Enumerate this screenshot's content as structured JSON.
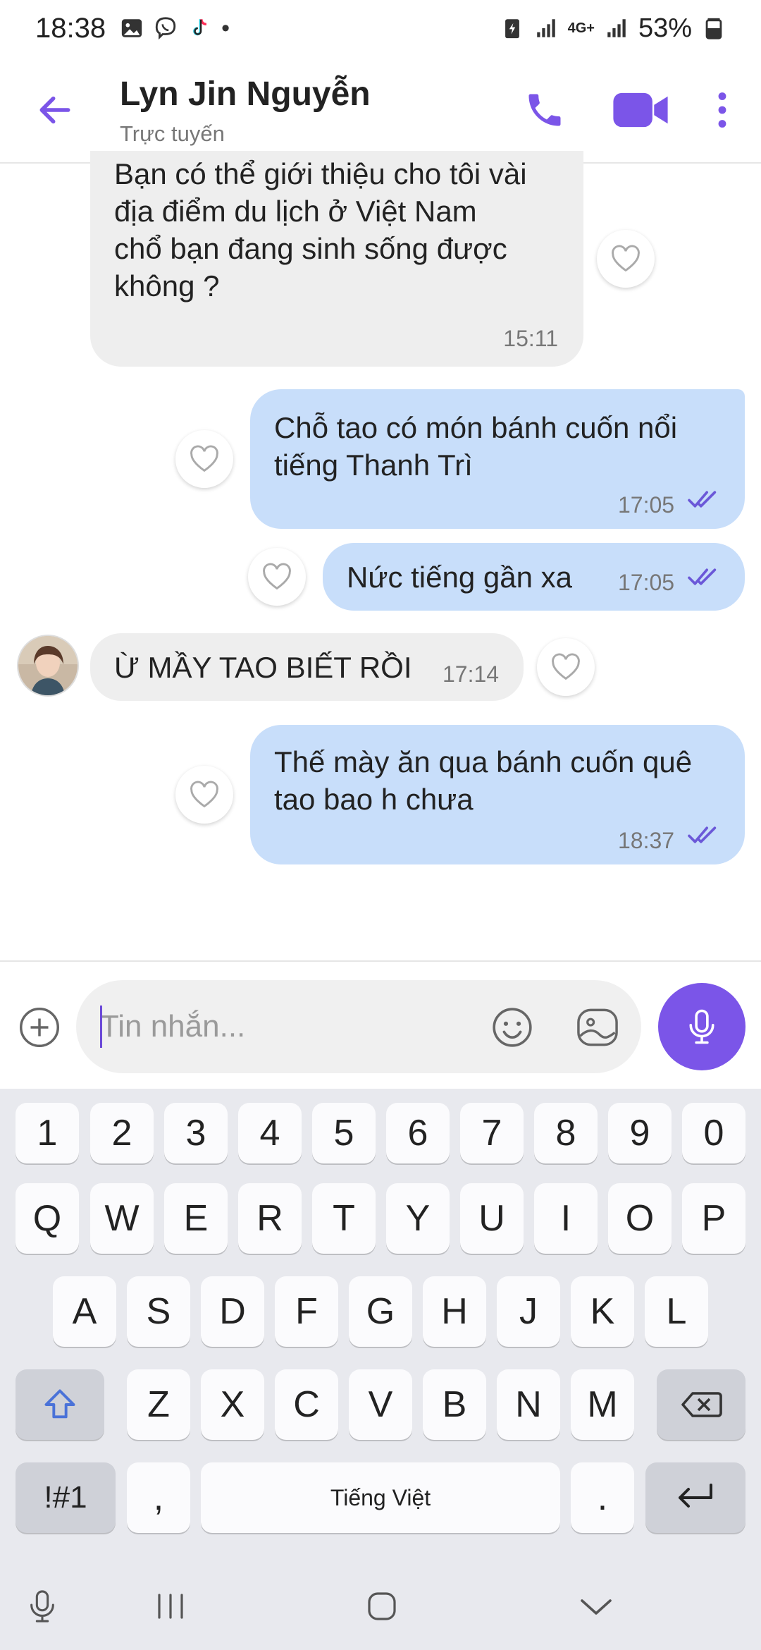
{
  "status_bar": {
    "time": "18:38",
    "dot": "•",
    "battery": "53%",
    "network": "4G+"
  },
  "header": {
    "title": "Lyn Jin Nguyễn",
    "subtitle": "Trực tuyến"
  },
  "messages": [
    {
      "direction": "in",
      "lines": [
        "Bạn có thể giới thiệu cho tôi vài",
        "địa điểm du lịch ở Việt Nam",
        "chổ bạn đang sinh sống được",
        "không ?"
      ],
      "time": "15:11"
    },
    {
      "direction": "out",
      "lines": [
        "Chỗ tao có món bánh cuốn nổi",
        "tiếng Thanh Trì"
      ],
      "time": "17:05"
    },
    {
      "direction": "out",
      "lines": [
        "Nức tiếng gần xa"
      ],
      "time": "17:05"
    },
    {
      "direction": "in",
      "lines": [
        "Ừ MẦY TAO BIẾT RỒI"
      ],
      "time": "17:14"
    },
    {
      "direction": "out",
      "lines": [
        "Thế mày ăn qua bánh cuốn quê",
        "tao bao h chưa"
      ],
      "time": "18:37"
    }
  ],
  "composer": {
    "placeholder": "Tin nhắn..."
  },
  "keyboard": {
    "row_numbers": [
      "1",
      "2",
      "3",
      "4",
      "5",
      "6",
      "7",
      "8",
      "9",
      "0"
    ],
    "row_q": [
      "Q",
      "W",
      "E",
      "R",
      "T",
      "Y",
      "U",
      "I",
      "O",
      "P"
    ],
    "row_a": [
      "A",
      "S",
      "D",
      "F",
      "G",
      "H",
      "J",
      "K",
      "L"
    ],
    "row_z": [
      "Z",
      "X",
      "C",
      "V",
      "B",
      "N",
      "M"
    ],
    "symbols_label": "!#1",
    "comma": ",",
    "space_label": "Tiếng Việt",
    "period": "."
  },
  "colors": {
    "accent": "#7b55e8",
    "outgoing_bubble": "#c8defa",
    "incoming_bubble": "#eeeeee",
    "read_ticks": "#6b58d8"
  },
  "icons": {
    "back": "arrow-left-icon",
    "call": "phone-icon",
    "video": "video-camera-icon",
    "more": "more-vertical-icon",
    "like": "heart-icon",
    "plus": "plus-circle-icon",
    "emoji": "smiley-icon",
    "sticker": "sticker-icon",
    "mic": "microphone-icon"
  }
}
